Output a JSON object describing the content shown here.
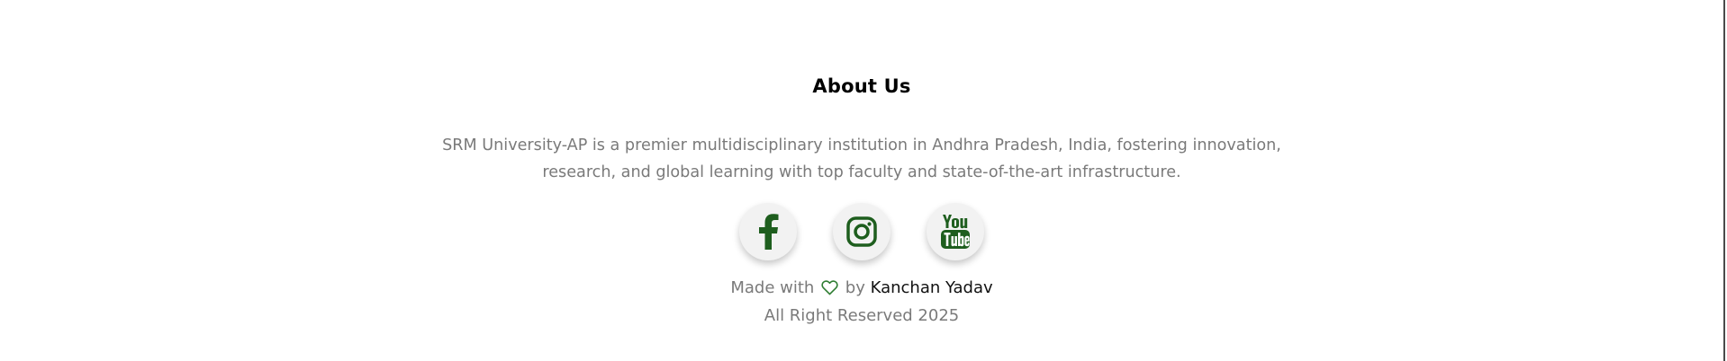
{
  "about": {
    "title": "About Us",
    "description": "SRM University-AP is a premier multidisciplinary institution in Andhra Pradesh, India, fostering innovation, research, and global learning with top faculty and state-of-the-art infrastructure."
  },
  "social": [
    {
      "icon": "facebook-icon"
    },
    {
      "icon": "instagram-icon"
    },
    {
      "icon": "youtube-icon"
    }
  ],
  "credit": {
    "prefix": "Made with",
    "by": "by",
    "author": "Kanchan Yadav",
    "icon": "heart-icon"
  },
  "rights": "All Right Reserved 2025",
  "colors": {
    "icon_green": "#1e5e1e",
    "text_gray": "#7a7a7a"
  }
}
